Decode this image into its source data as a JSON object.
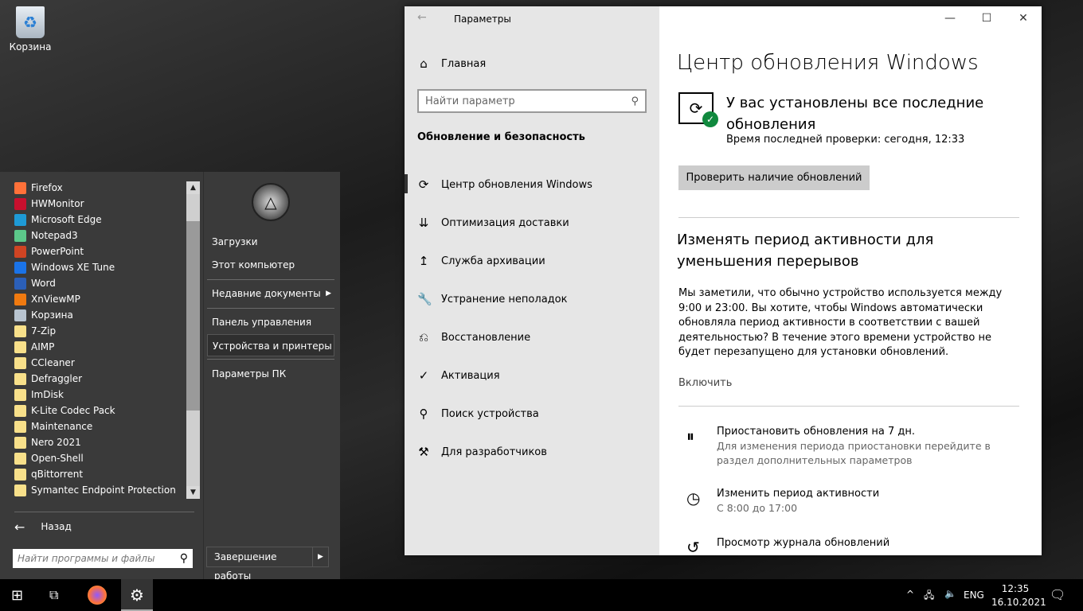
{
  "desktop": {
    "recycle_bin": "Корзина"
  },
  "start_menu": {
    "programs": [
      {
        "label": "Firefox",
        "icon": "firefox-icon",
        "color": "#ff7139"
      },
      {
        "label": "HWMonitor",
        "icon": "hwmonitor-icon",
        "color": "#c8102e"
      },
      {
        "label": "Microsoft Edge",
        "icon": "edge-icon",
        "color": "#1e9ad6"
      },
      {
        "label": "Notepad3",
        "icon": "notepad3-icon",
        "color": "#5cc88a"
      },
      {
        "label": "PowerPoint",
        "icon": "powerpoint-icon",
        "color": "#d04423"
      },
      {
        "label": "Windows XE Tune",
        "icon": "gear-icon",
        "color": "#1a73e8"
      },
      {
        "label": "Word",
        "icon": "word-icon",
        "color": "#2b5fb8"
      },
      {
        "label": "XnViewMP",
        "icon": "xnview-icon",
        "color": "#f07a10"
      },
      {
        "label": "Корзина",
        "icon": "recycle-bin-icon",
        "color": "#b8c4d0"
      },
      {
        "label": "7-Zip",
        "icon": "folder-icon",
        "color": "#f8e08a"
      },
      {
        "label": "AIMP",
        "icon": "folder-icon",
        "color": "#f8e08a"
      },
      {
        "label": "CCleaner",
        "icon": "folder-icon",
        "color": "#f8e08a"
      },
      {
        "label": "Defraggler",
        "icon": "folder-icon",
        "color": "#f8e08a"
      },
      {
        "label": "ImDisk",
        "icon": "folder-icon",
        "color": "#f8e08a"
      },
      {
        "label": "K-Lite Codec Pack",
        "icon": "folder-icon",
        "color": "#f8e08a"
      },
      {
        "label": "Maintenance",
        "icon": "folder-icon",
        "color": "#f8e08a"
      },
      {
        "label": "Nero 2021",
        "icon": "folder-icon",
        "color": "#f8e08a"
      },
      {
        "label": "Open-Shell",
        "icon": "folder-icon",
        "color": "#f8e08a"
      },
      {
        "label": "qBittorrent",
        "icon": "folder-icon",
        "color": "#f8e08a"
      },
      {
        "label": "Symantec Endpoint Protection",
        "icon": "folder-icon",
        "color": "#f8e08a"
      }
    ],
    "back": "Назад",
    "search_placeholder": "Найти программы и файлы",
    "right": {
      "downloads": "Загрузки",
      "computer": "Этот компьютер",
      "recent": "Недавние документы",
      "control_panel": "Панель управления",
      "devices": "Устройства и принтеры",
      "pc_settings": "Параметры ПК",
      "shutdown": "Завершение работы"
    }
  },
  "settings": {
    "title": "Параметры",
    "home": "Главная",
    "search_placeholder": "Найти параметр",
    "section": "Обновление и безопасность",
    "nav": [
      {
        "label": "Центр обновления Windows",
        "icon": "sync-icon"
      },
      {
        "label": "Оптимизация доставки",
        "icon": "delivery-icon"
      },
      {
        "label": "Служба архивации",
        "icon": "backup-icon"
      },
      {
        "label": "Устранение неполадок",
        "icon": "wrench-icon"
      },
      {
        "label": "Восстановление",
        "icon": "recovery-icon"
      },
      {
        "label": "Активация",
        "icon": "check-circle-icon"
      },
      {
        "label": "Поиск устройства",
        "icon": "find-device-icon"
      },
      {
        "label": "Для разработчиков",
        "icon": "developer-icon"
      }
    ],
    "page_title": "Центр обновления Windows",
    "status": "У вас установлены все последние обновления",
    "last_check": "Время последней проверки: сегодня, 12:33",
    "check_button": "Проверить наличие обновлений",
    "active_heading": "Изменять период активности для уменьшения перерывов",
    "active_text": "Мы заметили, что обычно устройство используется между 9:00 и 23:00. Вы хотите, чтобы Windows автоматически обновляла период активности в соответствии с вашей деятельностью? В течение этого времени устройство не будет перезапущено для установки обновлений.",
    "enable": "Включить",
    "options": [
      {
        "title": "Приостановить обновления на 7 дн.",
        "sub": "Для изменения периода приостановки перейдите в раздел дополнительных параметров",
        "icon": "pause-icon"
      },
      {
        "title": "Изменить период активности",
        "sub": "С 8:00 до 17:00",
        "icon": "active-hours-icon"
      },
      {
        "title": "Просмотр журнала обновлений",
        "sub": "",
        "icon": "history-icon"
      }
    ]
  },
  "taskbar": {
    "lang": "ENG",
    "time": "12:35",
    "date": "16.10.2021"
  }
}
